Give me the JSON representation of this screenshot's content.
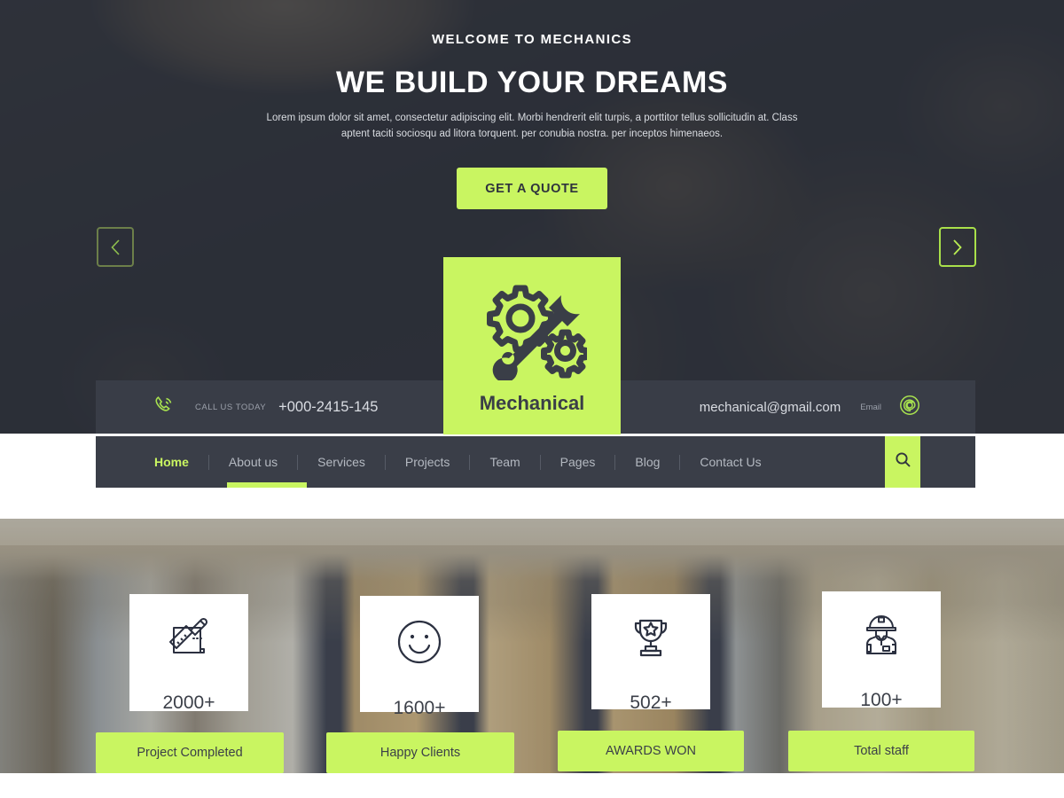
{
  "hero": {
    "eyebrow": "WELCOME TO MECHANICS",
    "headline": "WE BUILD YOUR DREAMS",
    "lead": "Lorem ipsum dolor sit amet, consectetur adipiscing elit. Morbi hendrerit elit turpis, a porttitor tellus sollicitudin at. Class aptent taciti sociosqu ad litora torquent.  per conubia nostra.  per inceptos himenaeos.",
    "cta_label": "GET A QUOTE",
    "prev_arrow": "chevron-left",
    "next_arrow": "chevron-right"
  },
  "logo": {
    "text": "Mechanical",
    "icon": "gear-wrench-icon"
  },
  "contact": {
    "phone_icon": "phone-icon",
    "phone_label": "CALL US TODAY",
    "phone_number": "+000-2415-145",
    "email_address": "mechanical@gmail.com",
    "email_label": "Email",
    "email_icon": "at-sign-icon"
  },
  "nav": {
    "items": [
      {
        "label": "Home",
        "active": true
      },
      {
        "label": "About us",
        "active": false
      },
      {
        "label": "Services",
        "active": false
      },
      {
        "label": "Projects",
        "active": false
      },
      {
        "label": "Team",
        "active": false
      },
      {
        "label": "Pages",
        "active": false
      },
      {
        "label": "Blog",
        "active": false
      },
      {
        "label": "Contact Us",
        "active": false
      }
    ],
    "search_icon": "search-icon"
  },
  "stats": [
    {
      "icon": "blueprint-pencil-icon",
      "value": "2000+",
      "label": "Project Completed"
    },
    {
      "icon": "smiley-face-icon",
      "value": "1600+",
      "label": "Happy Clients"
    },
    {
      "icon": "trophy-icon",
      "value": "502+",
      "label": "AWARDS WON"
    },
    {
      "icon": "worker-helmet-icon",
      "value": "100+",
      "label": "Total staff"
    }
  ],
  "colors": {
    "accent_green": "#c9f561",
    "dark_panel": "#3a3e48",
    "hero_overlay": "#2c2f38",
    "text_light": "#d9dce2",
    "text_muted": "#9ba0aa"
  }
}
